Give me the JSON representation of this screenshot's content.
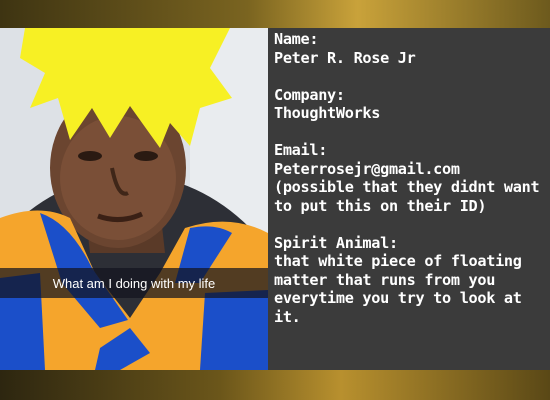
{
  "photo": {
    "caption": "What am I doing with my life"
  },
  "info": {
    "name_label": "Name:",
    "name_value": "Peter R. Rose Jr",
    "company_label": "Company:",
    "company_value": "ThoughtWorks",
    "email_label": "Email:",
    "email_value": "Peterrosejr@gmail.com",
    "email_note": "(possible that they didnt want to put this on their ID)",
    "animal_label": "Spirit Animal:",
    "animal_value": "that white piece of floating matter that runs from you everytime you try to look at it."
  },
  "colors": {
    "panel": "#3b3b3b",
    "hair": "#f7f024",
    "gi_orange": "#f5a52c",
    "gi_blue": "#1b4fc9",
    "caption_bar": "#14141e"
  }
}
